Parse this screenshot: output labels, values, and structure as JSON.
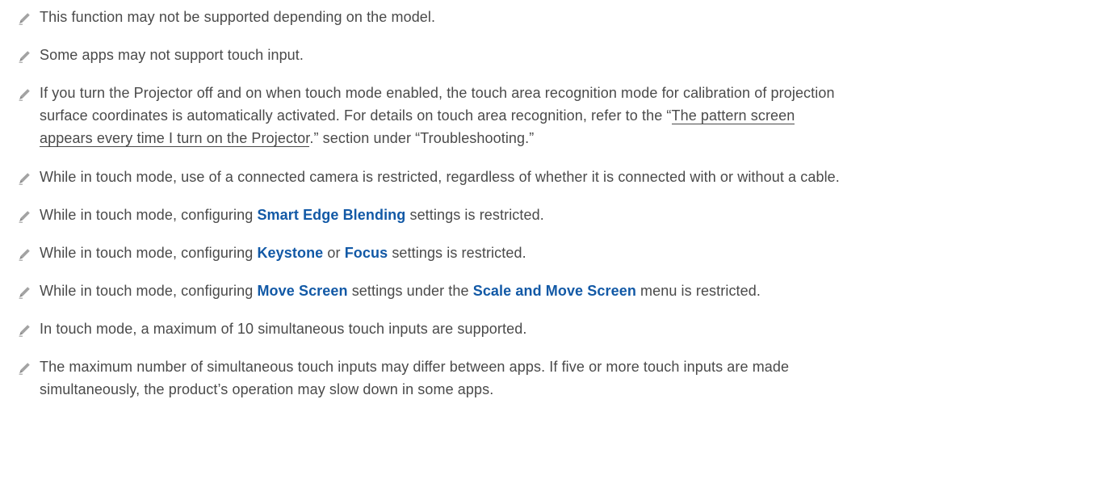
{
  "icons": {
    "note": "pencil-note-icon"
  },
  "colors": {
    "body_text": "#4a4a4a",
    "keyword": "#1259a6",
    "icon_gray": "#9a9a9a"
  },
  "notes": [
    {
      "text": "This function may not be supported depending on the model."
    },
    {
      "text": "Some apps may not support touch input."
    },
    {
      "line1": "If you turn the Projector off and on when touch mode enabled, the touch area recognition mode for calibration of projection",
      "line2_pre": "surface coordinates is automatically activated. For details on touch area recognition, refer to the “",
      "link_part1": "The pattern screen",
      "link_part2": "appears every time I turn on the Projector",
      "line3_post": ".” section under “Troubleshooting.”"
    },
    {
      "text": "While in touch mode, use of a connected camera is restricted, regardless of whether it is connected with or without a cable."
    },
    {
      "pre": "While in touch mode, configuring ",
      "kw1": "Smart Edge Blending",
      "post": " settings is restricted."
    },
    {
      "pre": "While in touch mode, configuring ",
      "kw1": "Keystone",
      "mid": " or ",
      "kw2": "Focus",
      "post": " settings is restricted."
    },
    {
      "pre": "While in touch mode, configuring ",
      "kw1": "Move Screen",
      "mid": " settings under the ",
      "kw2": "Scale and Move Screen",
      "post": " menu is restricted."
    },
    {
      "text": "In touch mode, a maximum of 10 simultaneous touch inputs are supported."
    },
    {
      "line1": "The maximum number of simultaneous touch inputs may differ between apps. If five or more touch inputs are made",
      "line2": "simultaneously, the product’s operation may slow down in some apps."
    }
  ]
}
